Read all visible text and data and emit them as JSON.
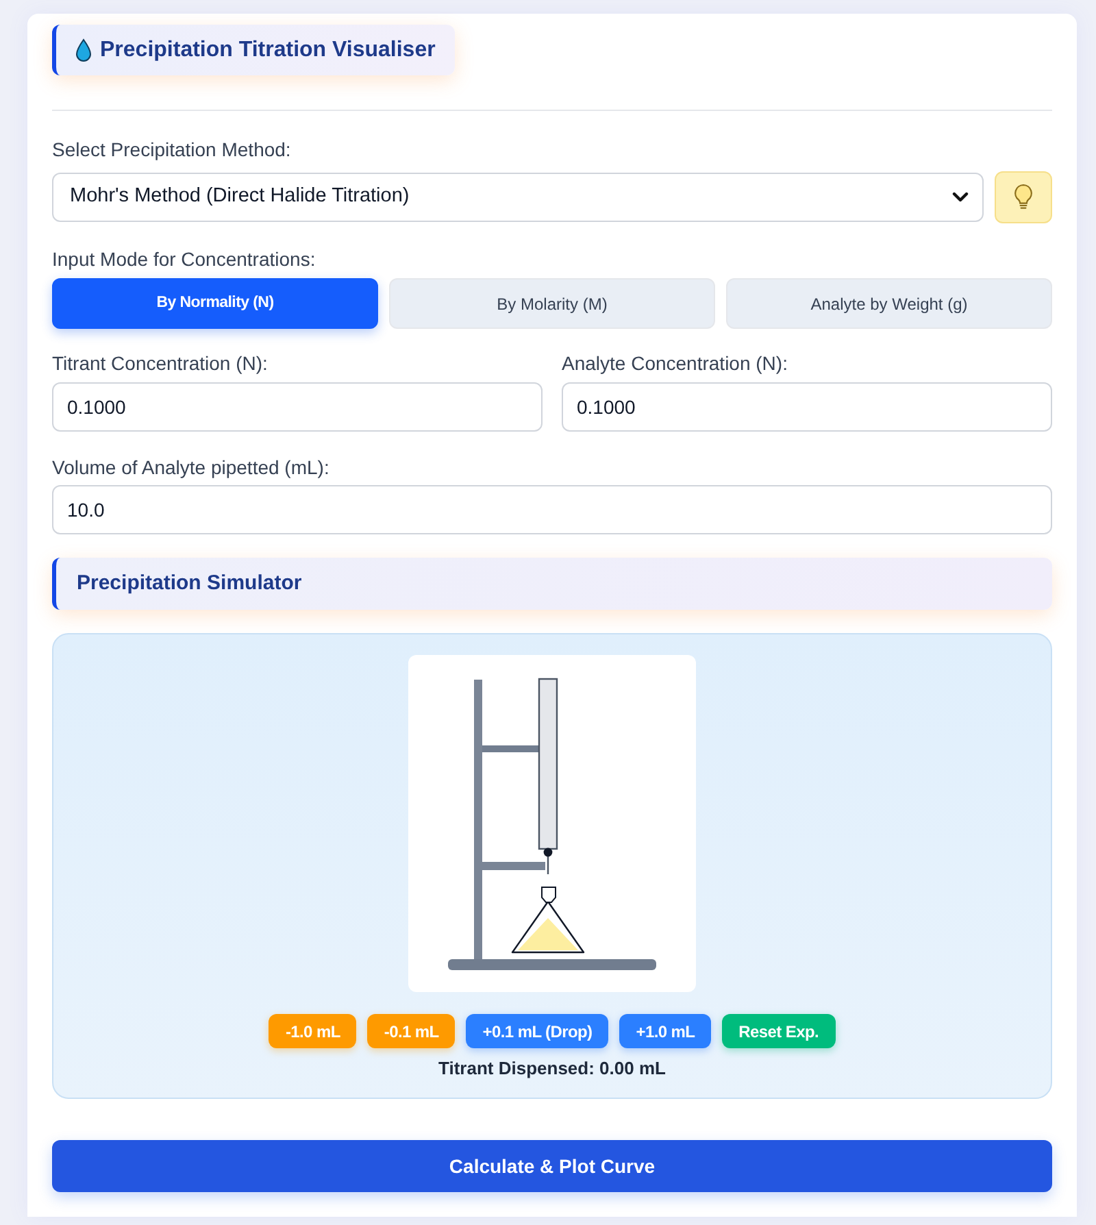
{
  "header": {
    "title": "Precipitation Titration Visualiser"
  },
  "method_select": {
    "label": "Select Precipitation Method:",
    "value": "Mohr's Method (Direct Halide Titration)"
  },
  "input_mode": {
    "label": "Input Mode for Concentrations:",
    "tabs": [
      {
        "label": "By Normality (N)",
        "selected": true
      },
      {
        "label": "By Molarity (M)",
        "selected": false
      },
      {
        "label": "Analyte by Weight (g)",
        "selected": false
      }
    ]
  },
  "concentration_fields": [
    {
      "label": "Titrant Concentration (N):",
      "value": "0.1000"
    },
    {
      "label": "Analyte Concentration (N):",
      "value": "0.1000"
    }
  ],
  "volume_field": {
    "label": "Volume of Analyte pipetted (mL):",
    "value": "10.0"
  },
  "simulator": {
    "title": "Precipitation Simulator",
    "buttons": [
      {
        "label": "-1.0 mL",
        "kind": "decrease"
      },
      {
        "label": "-0.1 mL",
        "kind": "decrease"
      },
      {
        "label": "+0.1 mL (Drop)",
        "kind": "increase"
      },
      {
        "label": "+1.0 mL",
        "kind": "increase"
      },
      {
        "label": "Reset Exp.",
        "kind": "reset"
      }
    ],
    "readout": "Titrant Dispensed: 0.00 mL"
  },
  "calculate_button": {
    "label": "Calculate & Plot Curve"
  }
}
